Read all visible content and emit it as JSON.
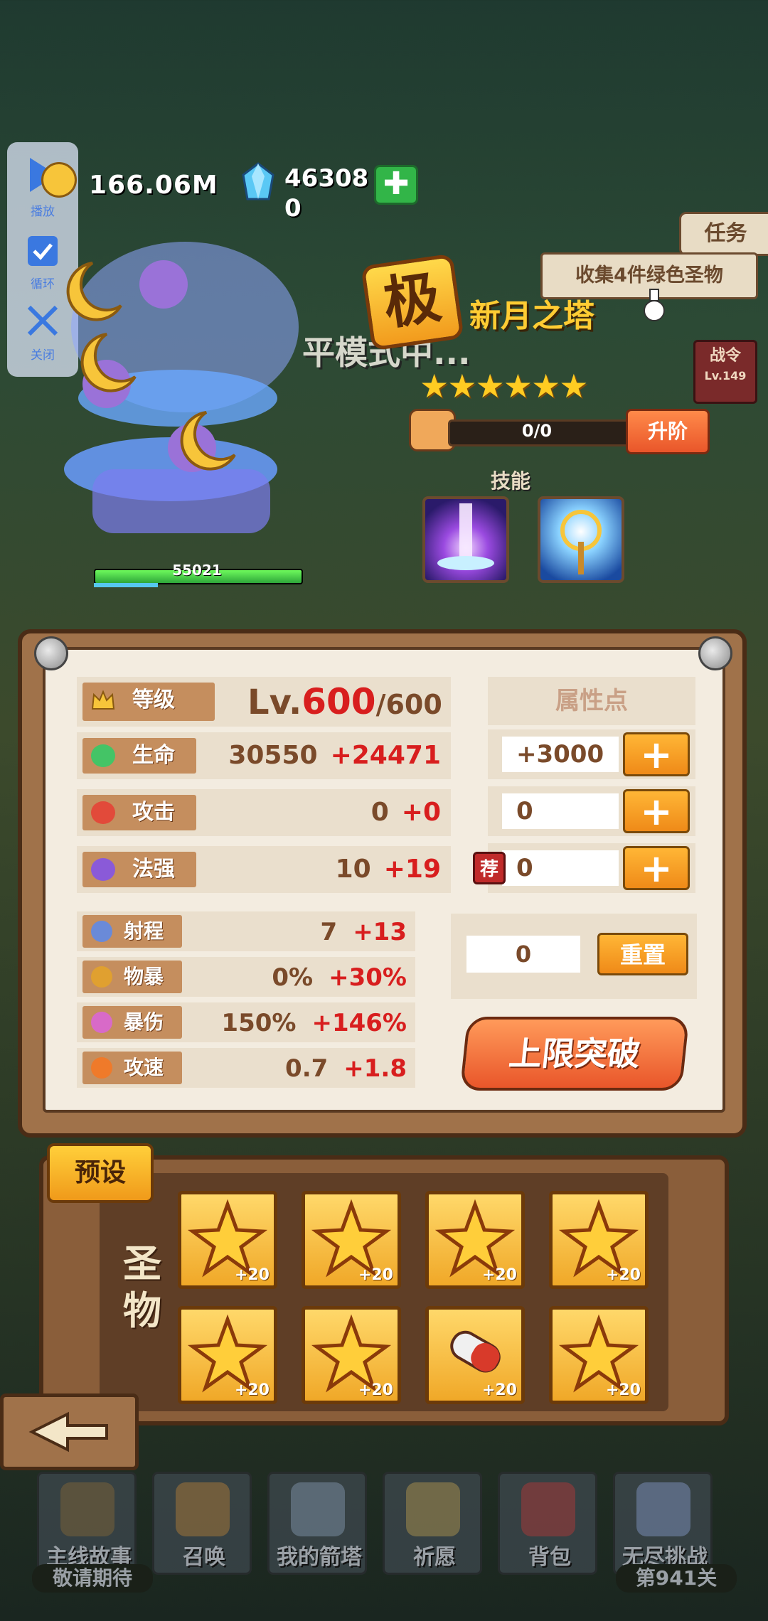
{
  "media_controls": {
    "play_label": "播放",
    "loop_label": "循环",
    "close_label": "关闭"
  },
  "currency": {
    "gold": "166.06M",
    "gems_line1": "46308",
    "gems_line2": "0",
    "add_symbol": "✚"
  },
  "quest": {
    "tab_label": "任务",
    "text": "收集4件绿色圣物"
  },
  "battle_pass": {
    "label": "战令",
    "level": "Lv.149"
  },
  "hero": {
    "hp_value": "55021",
    "hp_percent": 100,
    "rank_badge": "极",
    "name": "新月之塔",
    "stars": 6,
    "star_glyph": "★",
    "fair_mode_text": "平模式中...",
    "fragments": "0/0",
    "upgrade_label": "升阶",
    "skills_label": "技能"
  },
  "stats": {
    "level": {
      "label": "等级",
      "prefix": "Lv.",
      "current": "600",
      "max": "/600"
    },
    "rows": [
      {
        "label": "生命",
        "base": "30550",
        "bonus": "+24471"
      },
      {
        "label": "攻击",
        "base": "0",
        "bonus": "+0"
      },
      {
        "label": "法强",
        "base": "10",
        "bonus": "+19"
      }
    ],
    "secondary": [
      {
        "label": "射程",
        "base": "7",
        "bonus": "+13"
      },
      {
        "label": "物暴",
        "base": "0%",
        "bonus": "+30%"
      },
      {
        "label": "暴伤",
        "base": "150%",
        "bonus": "+146%"
      },
      {
        "label": "攻速",
        "base": "0.7",
        "bonus": "+1.8"
      }
    ]
  },
  "attributes": {
    "header": "属性点",
    "values": [
      "+3000",
      "0",
      "0"
    ],
    "add_symbol": "+",
    "recommend_badge": "荐",
    "reset_value": "0",
    "reset_label": "重置",
    "break_limit_label": "上限突破"
  },
  "relics": {
    "preset_label": "预设",
    "section_label_1": "圣",
    "section_label_2": "物",
    "items": [
      {
        "type": "star",
        "level": "+20"
      },
      {
        "type": "star",
        "level": "+20"
      },
      {
        "type": "star",
        "level": "+20"
      },
      {
        "type": "star",
        "level": "+20"
      },
      {
        "type": "star",
        "level": "+20"
      },
      {
        "type": "star",
        "level": "+20"
      },
      {
        "type": "capsule",
        "level": "+20"
      },
      {
        "type": "star",
        "level": "+20"
      }
    ]
  },
  "bottom_nav": {
    "items": [
      {
        "label": "主线故事",
        "icon": "book-icon"
      },
      {
        "label": "召唤",
        "icon": "scroll-icon"
      },
      {
        "label": "我的箭塔",
        "icon": "tower-icon"
      },
      {
        "label": "祈愿",
        "icon": "star-icon"
      },
      {
        "label": "背包",
        "icon": "backpack-icon"
      },
      {
        "label": "无尽挑战",
        "icon": "sword-icon"
      }
    ],
    "story_sub": "敬请期待",
    "challenge_sub": "第941关"
  }
}
